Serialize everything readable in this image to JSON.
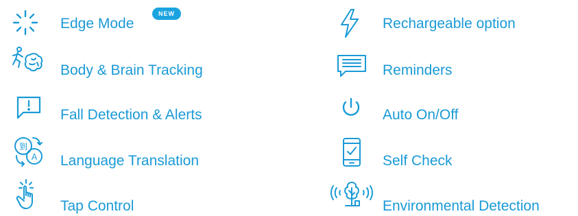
{
  "accent_color": "#1a9ad6",
  "features_left": [
    {
      "label": "Edge Mode",
      "icon": "sparkle-icon",
      "badge": "NEW"
    },
    {
      "label": "Body & Brain Tracking",
      "icon": "runner-brain-icon"
    },
    {
      "label": "Fall Detection & Alerts",
      "icon": "alert-message-icon"
    },
    {
      "label": "Language Translation",
      "icon": "translate-icon"
    },
    {
      "label": "Tap Control",
      "icon": "tap-hand-icon"
    }
  ],
  "features_right": [
    {
      "label": "Rechargeable option",
      "icon": "lightning-icon"
    },
    {
      "label": "Reminders",
      "icon": "message-lines-icon"
    },
    {
      "label": "Auto On/Off",
      "icon": "power-icon"
    },
    {
      "label": "Self Check",
      "icon": "phone-check-icon"
    },
    {
      "label": "Environmental Detection",
      "icon": "tree-sound-icon"
    }
  ]
}
